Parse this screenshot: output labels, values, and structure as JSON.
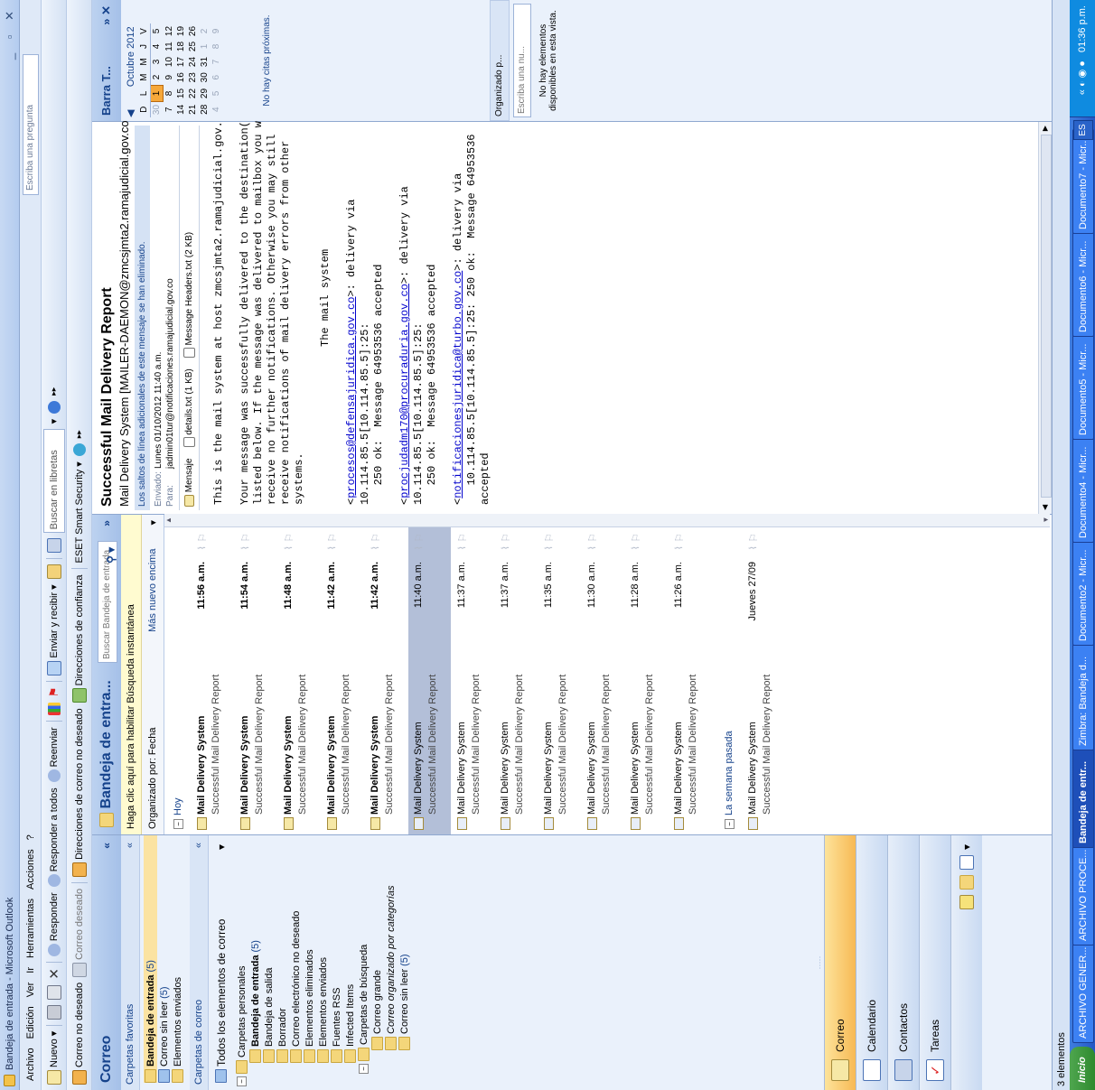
{
  "window": {
    "title": "Bandeja de entrada - Microsoft Outlook",
    "help_placeholder": "Escriba una pregunta"
  },
  "menu": [
    "Archivo",
    "Edición",
    "Ver",
    "Ir",
    "Herramientas",
    "Acciones",
    "?"
  ],
  "toolbar1": {
    "new": "Nuevo",
    "reply": "Responder",
    "reply_all": "Responder a todos",
    "forward": "Reenviar",
    "send_receive": "Enviar y recibir",
    "search_books": "Buscar en libretas"
  },
  "toolbar2": {
    "junk": "Correo no deseado",
    "not_junk": "Correo deseado",
    "junk_directions": "Direcciones de correo no deseado",
    "trusted_directions": "Direcciones de confianza",
    "eset": "ESET Smart Security"
  },
  "nav": {
    "title": "Correo",
    "favorites_header": "Carpetas favoritas",
    "favorites": [
      {
        "label": "Bandeja de entrada",
        "count": "(5)",
        "bold": true
      },
      {
        "label": "Correo sin leer",
        "count": "(5)",
        "bold": false
      },
      {
        "label": "Elementos enviados",
        "count": "",
        "bold": false
      }
    ],
    "mail_folders_header": "Carpetas de correo",
    "all_items": "Todos los elementos de correo",
    "tree": [
      {
        "label": "Carpetas personales",
        "count": "",
        "level": 0,
        "bold": false
      },
      {
        "label": "Bandeja de entrada",
        "count": "(5)",
        "level": 1,
        "bold": true
      },
      {
        "label": "Bandeja de salida",
        "count": "",
        "level": 1,
        "bold": false
      },
      {
        "label": "Borrador",
        "count": "",
        "level": 1,
        "bold": false
      },
      {
        "label": "Correo electrónico no deseado",
        "count": "",
        "level": 1,
        "bold": false
      },
      {
        "label": "Elementos eliminados",
        "count": "",
        "level": 1,
        "bold": false
      },
      {
        "label": "Elementos enviados",
        "count": "",
        "level": 1,
        "bold": false
      },
      {
        "label": "Fuentes RSS",
        "count": "",
        "level": 1,
        "bold": false
      },
      {
        "label": "Infected Items",
        "count": "",
        "level": 1,
        "bold": false
      },
      {
        "label": "Carpetas de búsqueda",
        "count": "",
        "level": 1,
        "bold": false
      },
      {
        "label": "Correo grande",
        "count": "",
        "level": 2,
        "bold": false
      },
      {
        "label": "Correo organizado por categorías",
        "count": "",
        "level": 2,
        "bold": false
      },
      {
        "label": "Correo sin leer",
        "count": "(5)",
        "level": 2,
        "bold": false
      }
    ],
    "buttons": [
      "Correo",
      "Calendario",
      "Contactos",
      "Tareas"
    ]
  },
  "list": {
    "title": "Bandeja de entra...",
    "search_placeholder": "Buscar Bandeja de entrada",
    "instant_search": "Haga clic aquí para habilitar Búsqueda instantánea",
    "arranged_by": "Organizado por: Fecha",
    "order": "Más nuevo encima",
    "group_today": "Hoy",
    "group_lastweek": "La semana pasada",
    "messages": [
      {
        "from": "Mail Delivery System",
        "subject": "Successful Mail Delivery Report",
        "time": "11:56 a.m.",
        "unread": true
      },
      {
        "from": "Mail Delivery System",
        "subject": "Successful Mail Delivery Report",
        "time": "11:54 a.m.",
        "unread": true
      },
      {
        "from": "Mail Delivery System",
        "subject": "Successful Mail Delivery Report",
        "time": "11:48 a.m.",
        "unread": true
      },
      {
        "from": "Mail Delivery System",
        "subject": "Successful Mail Delivery Report",
        "time": "11:42 a.m.",
        "unread": true
      },
      {
        "from": "Mail Delivery System",
        "subject": "Successful Mail Delivery Report",
        "time": "11:42 a.m.",
        "unread": true
      },
      {
        "from": "Mail Delivery System",
        "subject": "Successful Mail Delivery Report",
        "time": "11:40 a.m.",
        "unread": false,
        "selected": true
      },
      {
        "from": "Mail Delivery System",
        "subject": "Successful Mail Delivery Report",
        "time": "11:37 a.m.",
        "unread": false
      },
      {
        "from": "Mail Delivery System",
        "subject": "Successful Mail Delivery Report",
        "time": "11:37 a.m.",
        "unread": false
      },
      {
        "from": "Mail Delivery System",
        "subject": "Successful Mail Delivery Report",
        "time": "11:35 a.m.",
        "unread": false
      },
      {
        "from": "Mail Delivery System",
        "subject": "Successful Mail Delivery Report",
        "time": "11:30 a.m.",
        "unread": false
      },
      {
        "from": "Mail Delivery System",
        "subject": "Successful Mail Delivery Report",
        "time": "11:28 a.m.",
        "unread": false
      },
      {
        "from": "Mail Delivery System",
        "subject": "Successful Mail Delivery Report",
        "time": "11:26 a.m.",
        "unread": false
      }
    ],
    "lastweek_message": {
      "from": "Mail Delivery System",
      "subject": "Successful Mail Delivery Report",
      "time": "Jueves 27/09"
    }
  },
  "reading": {
    "subject": "Successful Mail Delivery Report",
    "from": "Mail Delivery System [MAILER-DAEMON@zmcsjmta2.ramajudicial.gov.co]",
    "info": "Los saltos de línea adicionales de este mensaje se han eliminado.",
    "sent_label": "Enviado:",
    "sent_value": "Lunes 01/10/2012 11:40 a.m.",
    "to_label": "Para:",
    "to_value": "jadmin01tur@notificaciones.ramajudicial.gov.co",
    "attachments": [
      "Mensaje",
      "details.txt (1 KB)",
      "Message Headers.txt (2 KB)"
    ],
    "body_intro": "This is the mail system at host zmcsjmta2.ramajudicial.gov.co.",
    "body_p2": [
      "Your message was successfully delivered to the destination(s)",
      "listed below. If the message was delivered to mailbox you will",
      "receive no further notifications. Otherwise you may still",
      "receive notifications of mail delivery errors from other",
      "systems."
    ],
    "signature": "The mail system",
    "deliveries": [
      {
        "addr": "procesos@defensajuridica.gov.co",
        "after": ">: delivery via",
        "l2": "10.114.85.5[10.114.85.5]:25:",
        "l3": "   250 ok:  Message 64953536 accepted"
      },
      {
        "addr": "procjudadm170@procuraduria.gov.co",
        "after": ">: delivery via",
        "l2": "10.114.85.5[10.114.85.5]:25:",
        "l3": "   250 ok:  Message 64953536 accepted"
      },
      {
        "addr": "notificacionesjuridica@turbo.gov.co",
        "after": ">: delivery via",
        "l2": "   10.114.85.5[10.114.85.5]:25: 250 ok:  Message 64953536",
        "l3": "accepted"
      }
    ]
  },
  "todo": {
    "title": "Barra T...",
    "month": "Octubre 2012",
    "weekdays": [
      "D",
      "L",
      "M",
      "M",
      "J",
      "V"
    ],
    "weeks": [
      [
        "30",
        "1",
        "2",
        "3",
        "4",
        "5"
      ],
      [
        "7",
        "8",
        "9",
        "10",
        "11",
        "12"
      ],
      [
        "14",
        "15",
        "16",
        "17",
        "18",
        "19"
      ],
      [
        "21",
        "22",
        "23",
        "24",
        "25",
        "26"
      ],
      [
        "28",
        "29",
        "30",
        "31",
        "1",
        "2"
      ],
      [
        "4",
        "5",
        "6",
        "7",
        "8",
        "9"
      ]
    ],
    "no_appointments": "No hay citas próximas.",
    "arranged": "Organizado p...",
    "task_placeholder": "Escriba una nu...",
    "no_items": "No hay elementos disponibles en esta vista."
  },
  "status": "3 elementos",
  "taskbar": {
    "start": "Inicio",
    "items": [
      "ARCHIVO GENER...",
      "ARCHIVO PROCE...",
      "Bandeja de entr...",
      "Zimbra: Bandeja d...",
      "Documento2 - Micr...",
      "Documento4 - Micr...",
      "Documento5 - Micr...",
      "Documento6 - Micr...",
      "Documento7 - Micr..."
    ],
    "lang": "ES",
    "time": "01:36 p.m."
  }
}
